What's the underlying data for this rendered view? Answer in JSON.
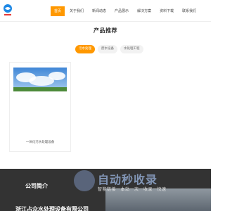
{
  "header": {
    "nav": [
      {
        "label": "首页",
        "active": true
      },
      {
        "label": "关于我们"
      },
      {
        "label": "新闻动态"
      },
      {
        "label": "产品展示"
      },
      {
        "label": "解决方案"
      },
      {
        "label": "资料下载"
      },
      {
        "label": "联系我们"
      }
    ]
  },
  "products": {
    "title": "产品推荐",
    "tabs": [
      {
        "label": "污水处理",
        "active": true
      },
      {
        "label": "废水设备"
      },
      {
        "label": "水处理工程"
      }
    ],
    "cards": [
      {
        "label": "一体化污水处理设备"
      }
    ]
  },
  "footer": {
    "heading": "公司简介",
    "company": "浙江占众水处理设备有限公司"
  },
  "watermark": {
    "main": "自动秒收录",
    "sub": "智能链接一本站一次一收录一快速"
  },
  "colors": {
    "accent": "#ff9800",
    "footer_bg": "#333333"
  }
}
